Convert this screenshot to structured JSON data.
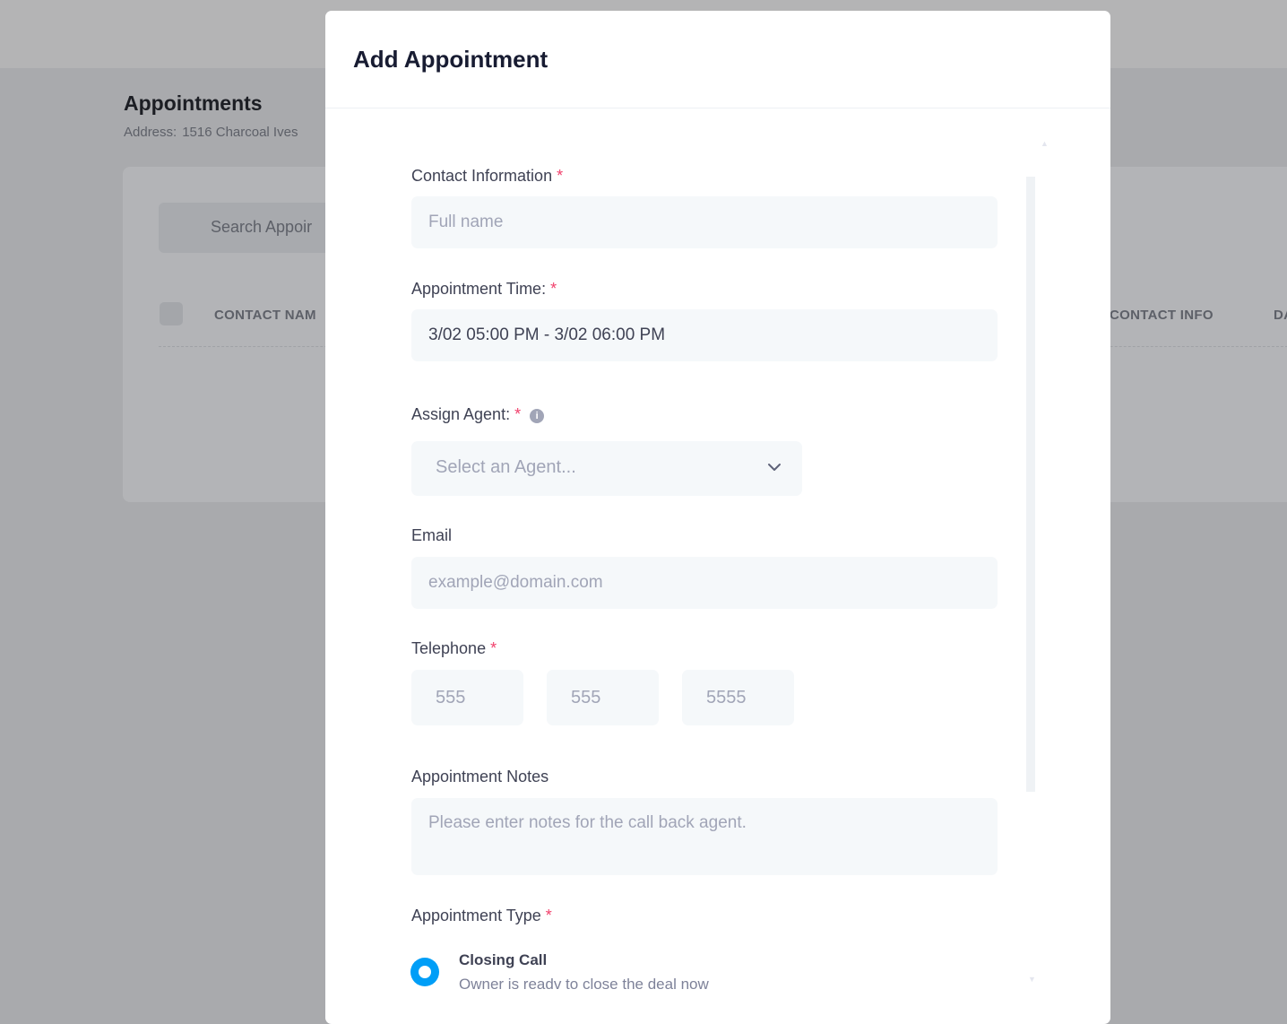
{
  "background_page": {
    "title": "Appointments",
    "address_label": "Address:",
    "address_value": "1516 Charcoal Ives",
    "search_placeholder": "Search Appoir",
    "columns": [
      "CONTACT NAM",
      "CONTACT INFO",
      "DA"
    ]
  },
  "modal": {
    "title": "Add Appointment",
    "contact": {
      "label": "Contact Information",
      "required": "*",
      "placeholder": "Full name"
    },
    "time": {
      "label": "Appointment Time:",
      "required": "*",
      "value": "3/02 05:00 PM - 3/02 06:00 PM"
    },
    "agent": {
      "label": "Assign Agent:",
      "required": "*",
      "info_icon": "i",
      "placeholder": "Select an Agent..."
    },
    "email": {
      "label": "Email",
      "placeholder": "example@domain.com"
    },
    "telephone": {
      "label": "Telephone",
      "required": "*",
      "area_placeholder": "555",
      "prefix_placeholder": "555",
      "line_placeholder": "5555"
    },
    "notes": {
      "label": "Appointment Notes",
      "placeholder": "Please enter notes for the call back agent."
    },
    "type": {
      "label": "Appointment Type",
      "required": "*",
      "options": [
        {
          "title": "Closing Call",
          "description": "Owner is readv to close the deal now",
          "selected": true
        }
      ]
    }
  },
  "colors": {
    "accent": "#009ef7",
    "required": "#f1416c",
    "input_bg": "#f5f8fa",
    "overlay": "#a9aaad"
  },
  "icons": {
    "info": "info-circle-icon",
    "dropdown": "chevron-down-icon",
    "radio": "radio-selected-icon"
  }
}
